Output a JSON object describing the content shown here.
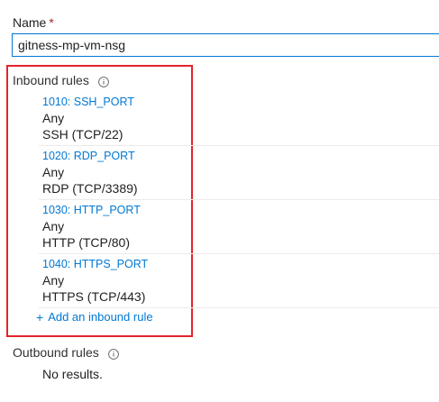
{
  "name_field": {
    "label": "Name",
    "required_marker": "*",
    "value": "gitness-mp-vm-nsg"
  },
  "inbound": {
    "title": "Inbound rules",
    "rules": [
      {
        "link": "1010: SSH_PORT",
        "source": "Any",
        "service": "SSH (TCP/22)"
      },
      {
        "link": "1020: RDP_PORT",
        "source": "Any",
        "service": "RDP (TCP/3389)"
      },
      {
        "link": "1030: HTTP_PORT",
        "source": "Any",
        "service": "HTTP (TCP/80)"
      },
      {
        "link": "1040: HTTPS_PORT",
        "source": "Any",
        "service": "HTTPS (TCP/443)"
      }
    ],
    "add_label": "Add an inbound rule"
  },
  "outbound": {
    "title": "Outbound rules",
    "empty_text": "No results."
  },
  "colors": {
    "link": "#0078d4",
    "highlight": "#e3242b",
    "required": "#a4262c"
  }
}
